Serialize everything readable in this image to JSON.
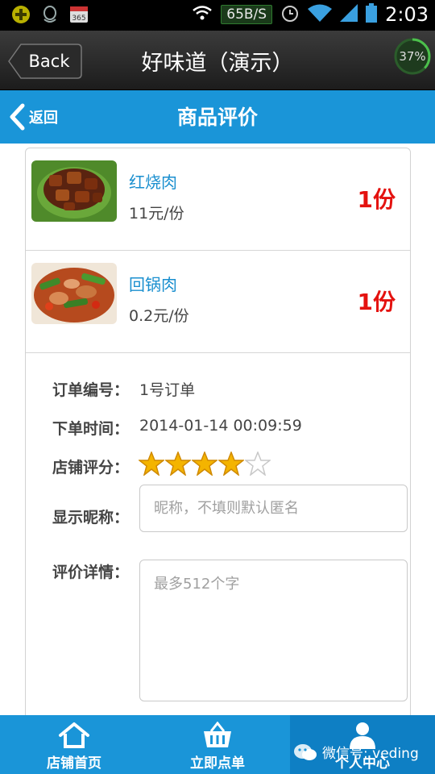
{
  "status_bar": {
    "net_speed": "65B/S",
    "time": "2:03",
    "left_icons": [
      "plus-circle-icon",
      "qq-icon",
      "calendar-365-icon"
    ],
    "right_icons": [
      "wifi-icon",
      "alarm-icon",
      "wifi-strong-icon",
      "signal-icon",
      "battery-icon"
    ],
    "calendar_text": "365"
  },
  "titlebar": {
    "back_label": "Back",
    "title": "好味道（演示）",
    "progress_percent": 37,
    "progress_label": "37%"
  },
  "header": {
    "back_label": "返回",
    "title": "商品评价"
  },
  "items": [
    {
      "name": "红烧肉",
      "price": "11元/份",
      "qty": "1份",
      "image": "braised-pork-photo"
    },
    {
      "name": "回锅肉",
      "price": "0.2元/份",
      "qty": "1份",
      "image": "twice-cooked-pork-photo"
    }
  ],
  "order": {
    "number_label": "订单编号：",
    "number_value": "1号订单",
    "time_label": "下单时间：",
    "time_value": "2014-01-14 00:09:59",
    "rating_label": "店铺评分：",
    "rating": 4,
    "rating_max": 5,
    "nickname_label": "显示昵称：",
    "nickname_placeholder": "昵称，不填则默认匿名",
    "detail_label": "评价详情：",
    "detail_placeholder": "最多512个字"
  },
  "bottom_nav": [
    {
      "label": "店铺首页",
      "icon": "home-icon"
    },
    {
      "label": "立即点单",
      "icon": "basket-icon"
    },
    {
      "label": "个人中心",
      "icon": "person-icon"
    }
  ],
  "watermark": "微信号: veding",
  "colors": {
    "accent": "#1a95d8",
    "qty_red": "#e4120f",
    "item_name_blue": "#1a8fcf",
    "star_gold": "#f4b400"
  }
}
